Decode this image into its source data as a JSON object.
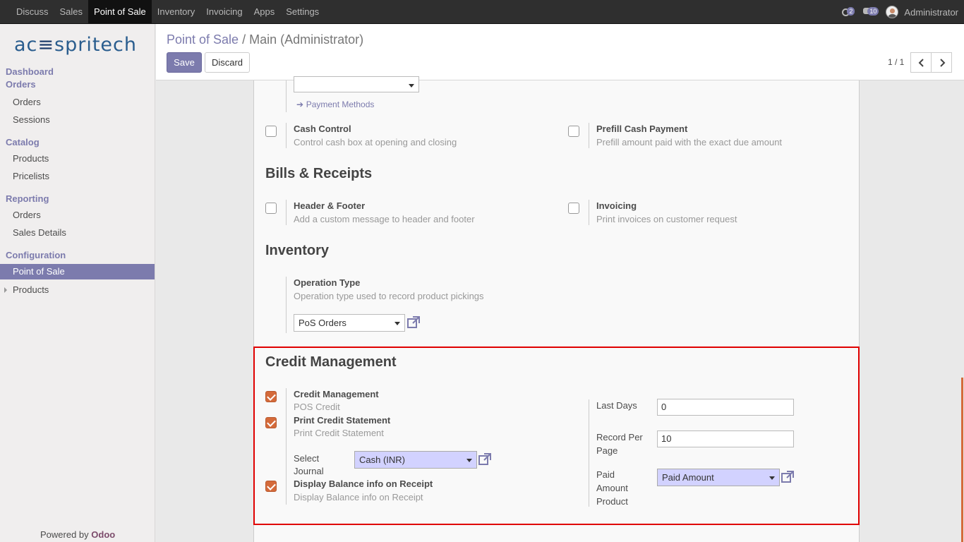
{
  "topbar": {
    "menu": [
      "Discuss",
      "Sales",
      "Point of Sale",
      "Inventory",
      "Invoicing",
      "Apps",
      "Settings"
    ],
    "active": "Point of Sale",
    "activity_count": "2",
    "message_count": "10",
    "user": "Administrator"
  },
  "sidebar": {
    "logo": "acespritech",
    "dashboard": "Dashboard",
    "orders_header": "Orders",
    "orders_items": [
      "Orders",
      "Sessions"
    ],
    "catalog_header": "Catalog",
    "catalog_items": [
      "Products",
      "Pricelists"
    ],
    "reporting_header": "Reporting",
    "reporting_items": [
      "Orders",
      "Sales Details"
    ],
    "configuration_header": "Configuration",
    "configuration_items": [
      "Point of Sale",
      "Products"
    ],
    "powered_prefix": "Powered by",
    "powered_brand": "Odoo"
  },
  "control_panel": {
    "breadcrumb_parent": "Point of Sale",
    "breadcrumb_sep": "/",
    "breadcrumb_current": "Main (Administrator)",
    "save_label": "Save",
    "discard_label": "Discard",
    "pager": "1 / 1"
  },
  "form": {
    "payment_methods_link": "Payment Methods",
    "cash_control": {
      "label": "Cash Control",
      "desc": "Control cash box at opening and closing",
      "checked": false
    },
    "prefill_cash": {
      "label": "Prefill Cash Payment",
      "desc": "Prefill amount paid with the exact due amount",
      "checked": false
    },
    "bills_title": "Bills & Receipts",
    "header_footer": {
      "label": "Header & Footer",
      "desc": "Add a custom message to header and footer",
      "checked": false
    },
    "invoicing": {
      "label": "Invoicing",
      "desc": "Print invoices on customer request",
      "checked": false
    },
    "inventory_title": "Inventory",
    "operation_type": {
      "label": "Operation Type",
      "desc": "Operation type used to record product pickings",
      "value": "PoS Orders"
    },
    "credit_title": "Credit Management",
    "credit_management": {
      "label": "Credit Management",
      "desc": "POS Credit",
      "checked": true
    },
    "print_credit": {
      "label": "Print Credit Statement",
      "desc": "Print Credit Statement",
      "checked": true
    },
    "select_journal": {
      "label_line1": "Select",
      "label_line2": "Journal",
      "value": "Cash (INR)"
    },
    "display_balance": {
      "label": "Display Balance info on Receipt",
      "desc": "Display Balance info on Receipt",
      "checked": true
    },
    "last_days": {
      "label": "Last Days",
      "value": "0"
    },
    "record_per_page": {
      "label_line1": "Record Per",
      "label_line2": "Page",
      "value": "10"
    },
    "paid_amount_product": {
      "label_line1": "Paid",
      "label_line2": "Amount",
      "label_line3": "Product",
      "value": "Paid Amount"
    }
  },
  "colors": {
    "accent": "#7c7bad",
    "checkbox_on": "#d46a3a",
    "highlight_box": "#e00000",
    "required_field": "#d2d2ff"
  }
}
